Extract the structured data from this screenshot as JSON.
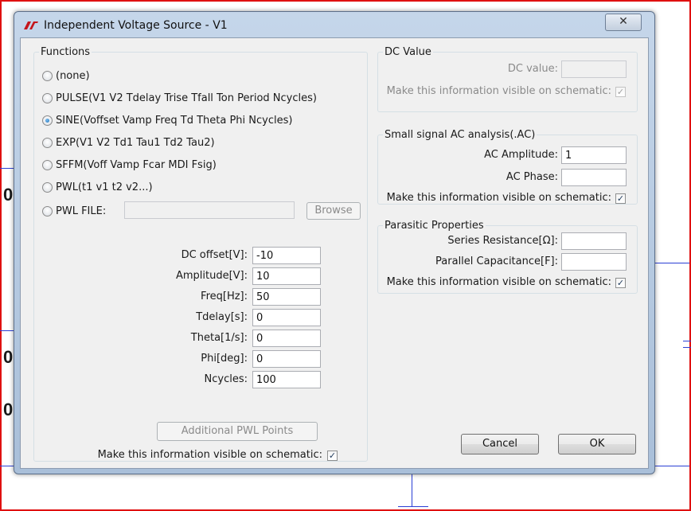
{
  "window": {
    "title": "Independent Voltage Source - V1",
    "close_glyph": "✕"
  },
  "functions": {
    "group_label": "Functions",
    "options": [
      {
        "label": "(none)",
        "checked": false
      },
      {
        "label": "PULSE(V1 V2 Tdelay Trise Tfall Ton Period Ncycles)",
        "checked": false
      },
      {
        "label": "SINE(Voffset Vamp Freq Td Theta Phi Ncycles)",
        "checked": true
      },
      {
        "label": "EXP(V1 V2 Td1 Tau1 Td2 Tau2)",
        "checked": false
      },
      {
        "label": "SFFM(Voff Vamp Fcar MDI Fsig)",
        "checked": false
      },
      {
        "label": "PWL(t1 v1 t2 v2...)",
        "checked": false
      },
      {
        "label": "PWL FILE:",
        "checked": false
      }
    ],
    "pwl_file_value": "",
    "browse_label": "Browse",
    "params": [
      {
        "label": "DC offset[V]:",
        "value": "-10"
      },
      {
        "label": "Amplitude[V]:",
        "value": "10"
      },
      {
        "label": "Freq[Hz]:",
        "value": "50"
      },
      {
        "label": "Tdelay[s]:",
        "value": "0"
      },
      {
        "label": "Theta[1/s]:",
        "value": "0"
      },
      {
        "label": "Phi[deg]:",
        "value": "0"
      },
      {
        "label": "Ncycles:",
        "value": "100"
      }
    ],
    "additional_pwl_label": "Additional PWL Points",
    "visible_label": "Make this information visible on schematic:",
    "visible_checked": true
  },
  "dc_value": {
    "group_label": "DC Value",
    "field_label": "DC value:",
    "value": "",
    "visible_label": "Make this information visible on schematic:",
    "visible_checked": true
  },
  "ac": {
    "group_label": "Small signal AC analysis(.AC)",
    "amplitude_label": "AC Amplitude:",
    "amplitude_value": "1",
    "phase_label": "AC Phase:",
    "phase_value": "",
    "visible_label": "Make this information visible on schematic:",
    "visible_checked": true
  },
  "parasitic": {
    "group_label": "Parasitic Properties",
    "series_label": "Series Resistance[Ω]:",
    "series_value": "",
    "parallel_label": "Parallel Capacitance[F]:",
    "parallel_value": "",
    "visible_label": "Make this information visible on schematic:",
    "visible_checked": true
  },
  "buttons": {
    "cancel": "Cancel",
    "ok": "OK"
  },
  "schematic": {
    "labels": [
      "0",
      "0",
      "0"
    ]
  },
  "colors": {
    "frame_red": "#e01010",
    "wire_blue": "#2a3fd4",
    "check_color": "#1e395b"
  }
}
